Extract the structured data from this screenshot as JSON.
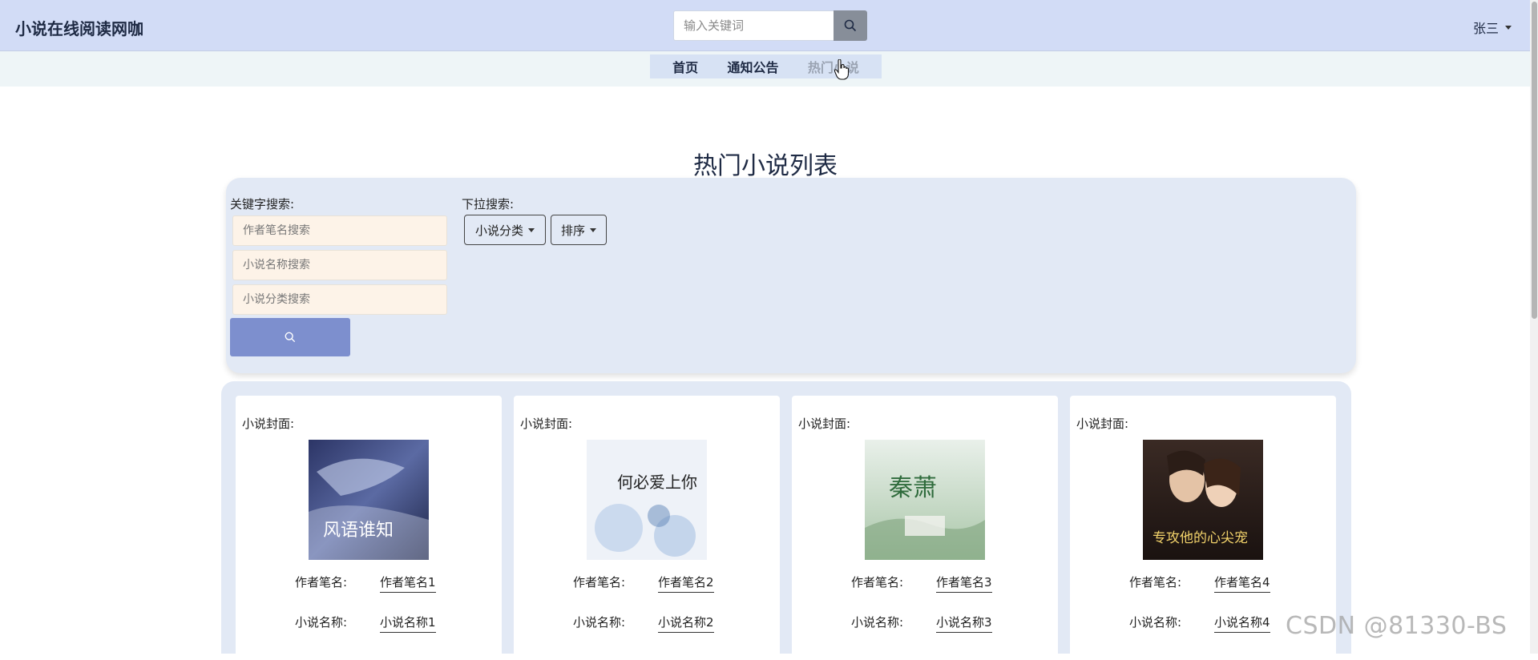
{
  "header": {
    "brand": "小说在线阅读网咖",
    "search_placeholder": "输入关键词",
    "user_name": "张三"
  },
  "nav": {
    "items": [
      {
        "label": "首页"
      },
      {
        "label": "通知公告"
      },
      {
        "label": "热门小说"
      }
    ],
    "active_index": 2
  },
  "page": {
    "title": "热门小说列表"
  },
  "search_panel": {
    "keyword_label": "关键字搜索:",
    "dropdown_label": "下拉搜索:",
    "author_placeholder": "作者笔名搜索",
    "name_placeholder": "小说名称搜索",
    "category_placeholder": "小说分类搜索",
    "category_dropdown": "小说分类",
    "sort_dropdown": "排序"
  },
  "cards": [
    {
      "cover_label": "小说封面:",
      "author_key": "作者笔名:",
      "author": "作者笔名1",
      "name_key": "小说名称:",
      "name": "小说名称1",
      "cover_text": "风语谁知"
    },
    {
      "cover_label": "小说封面:",
      "author_key": "作者笔名:",
      "author": "作者笔名2",
      "name_key": "小说名称:",
      "name": "小说名称2",
      "cover_text": "何必爱上你"
    },
    {
      "cover_label": "小说封面:",
      "author_key": "作者笔名:",
      "author": "作者笔名3",
      "name_key": "小说名称:",
      "name": "小说名称3",
      "cover_text": "秦萧"
    },
    {
      "cover_label": "小说封面:",
      "author_key": "作者笔名:",
      "author": "作者笔名4",
      "name_key": "小说名称:",
      "name": "小说名称4",
      "cover_text": "专攻他的心尖宠"
    }
  ],
  "watermark": "CSDN @81330-BS",
  "colors": {
    "header_bg": "#d2dcf6",
    "panel_bg": "#e2e9f5",
    "search_button": "#7d8fce",
    "input_bg": "#fdf3e8"
  }
}
